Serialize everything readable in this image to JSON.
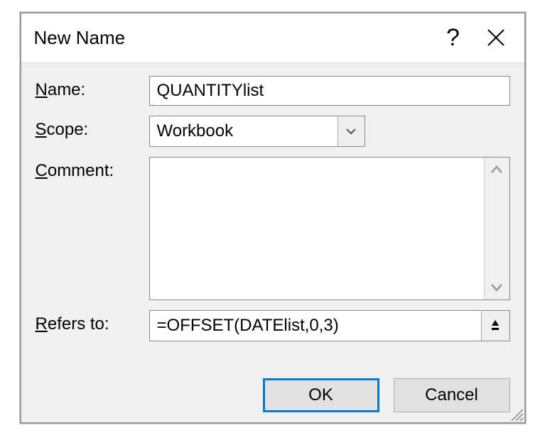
{
  "dialog": {
    "title": "New Name"
  },
  "labels": {
    "name": "ame:",
    "name_accel": "N",
    "scope": "cope:",
    "scope_accel": "S",
    "comment": "omment:",
    "comment_accel": "C",
    "refers": "efers to:",
    "refers_accel": "R"
  },
  "fields": {
    "name_value": "QUANTITYlist",
    "scope_value": "Workbook",
    "comment_value": "",
    "refers_value": "=OFFSET(DATElist,0,3)"
  },
  "buttons": {
    "ok": "OK",
    "cancel": "Cancel"
  }
}
